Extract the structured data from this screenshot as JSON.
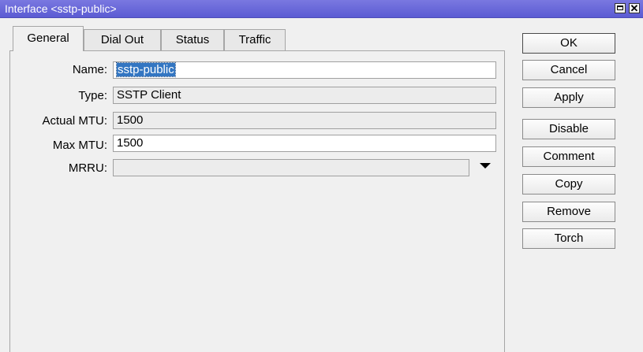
{
  "window": {
    "title": "Interface <sstp-public>",
    "close_label": "✕"
  },
  "tabs": [
    {
      "label": "General",
      "active": true
    },
    {
      "label": "Dial Out",
      "active": false
    },
    {
      "label": "Status",
      "active": false
    },
    {
      "label": "Traffic",
      "active": false
    }
  ],
  "form": {
    "name": {
      "label": "Name:",
      "value": "sstp-public"
    },
    "type": {
      "label": "Type:",
      "value": "SSTP Client"
    },
    "actual_mtu": {
      "label": "Actual MTU:",
      "value": "1500"
    },
    "max_mtu": {
      "label": "Max MTU:",
      "value": "1500"
    },
    "mrru": {
      "label": "MRRU:",
      "value": ""
    }
  },
  "buttons": {
    "ok": "OK",
    "cancel": "Cancel",
    "apply": "Apply",
    "disable": "Disable",
    "comment": "Comment",
    "copy": "Copy",
    "remove": "Remove",
    "torch": "Torch"
  },
  "colors": {
    "titlebar": "#5b5bd3",
    "selection": "#3376c2"
  }
}
